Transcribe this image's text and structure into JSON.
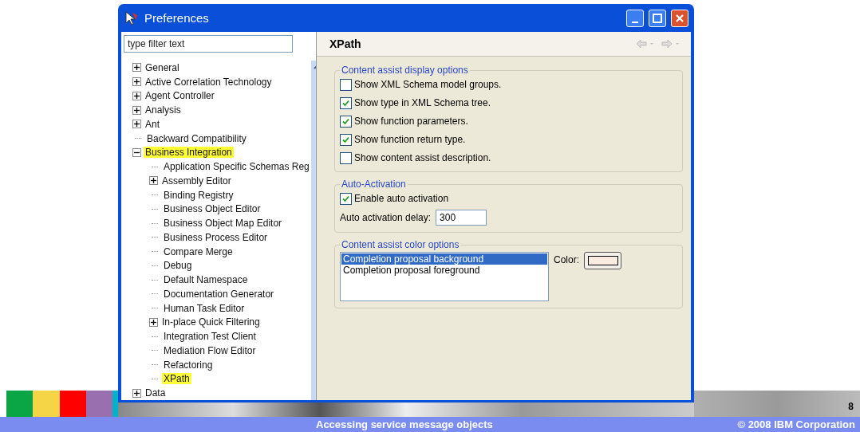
{
  "window": {
    "title": "Preferences"
  },
  "filter": {
    "placeholder": "type filter text"
  },
  "tree": [
    {
      "label": "General",
      "kind": "folder",
      "expanded": false,
      "highlighted": false
    },
    {
      "label": "Active Correlation Technology",
      "kind": "folder",
      "expanded": false,
      "highlighted": false
    },
    {
      "label": "Agent Controller",
      "kind": "folder",
      "expanded": false,
      "highlighted": false
    },
    {
      "label": "Analysis",
      "kind": "folder",
      "expanded": false,
      "highlighted": false
    },
    {
      "label": "Ant",
      "kind": "folder",
      "expanded": false,
      "highlighted": false
    },
    {
      "label": "Backward Compatibility",
      "kind": "leaf",
      "highlighted": false
    },
    {
      "label": "Business Integration",
      "kind": "folder",
      "expanded": true,
      "highlighted": true,
      "children": [
        {
          "label": "Application Specific Schemas Reg",
          "kind": "leaf",
          "highlighted": false
        },
        {
          "label": "Assembly Editor",
          "kind": "folder",
          "expanded": false,
          "highlighted": false
        },
        {
          "label": "Binding Registry",
          "kind": "leaf",
          "highlighted": false
        },
        {
          "label": "Business Object Editor",
          "kind": "leaf",
          "highlighted": false
        },
        {
          "label": "Business Object Map Editor",
          "kind": "leaf",
          "highlighted": false
        },
        {
          "label": "Business Process Editor",
          "kind": "leaf",
          "highlighted": false
        },
        {
          "label": "Compare Merge",
          "kind": "leaf",
          "highlighted": false
        },
        {
          "label": "Debug",
          "kind": "leaf",
          "highlighted": false
        },
        {
          "label": "Default Namespace",
          "kind": "leaf",
          "highlighted": false
        },
        {
          "label": "Documentation Generator",
          "kind": "leaf",
          "highlighted": false
        },
        {
          "label": "Human Task Editor",
          "kind": "leaf",
          "highlighted": false
        },
        {
          "label": "In-place Quick Filtering",
          "kind": "folder",
          "expanded": false,
          "highlighted": false
        },
        {
          "label": "Integration Test Client",
          "kind": "leaf",
          "highlighted": false
        },
        {
          "label": "Mediation Flow Editor",
          "kind": "leaf",
          "highlighted": false
        },
        {
          "label": "Refactoring",
          "kind": "leaf",
          "highlighted": false
        },
        {
          "label": "XPath",
          "kind": "leaf",
          "highlighted": true
        }
      ]
    },
    {
      "label": "Data",
      "kind": "folder",
      "expanded": false,
      "highlighted": false
    }
  ],
  "page": {
    "title": "XPath",
    "display_group": {
      "title": "Content assist display options",
      "options": [
        {
          "label": "Show XML Schema model groups.",
          "checked": false
        },
        {
          "label": "Show type in XML Schema tree.",
          "checked": true
        },
        {
          "label": "Show function parameters.",
          "checked": true
        },
        {
          "label": "Show function return type.",
          "checked": true
        },
        {
          "label": "Show content assist description.",
          "checked": false
        }
      ]
    },
    "activation_group": {
      "title": "Auto-Activation",
      "enable": {
        "label": "Enable auto activation",
        "checked": true
      },
      "delay_label": "Auto activation delay:",
      "delay_value": "300"
    },
    "color_group": {
      "title": "Content assist color options",
      "items": [
        {
          "label": "Completion proposal background",
          "selected": true
        },
        {
          "label": "Completion proposal foreground",
          "selected": false
        }
      ],
      "color_label": "Color:"
    }
  },
  "footer": {
    "page_number": "8",
    "title": "Accessing service message objects",
    "copyright": "© 2008 IBM Corporation"
  }
}
